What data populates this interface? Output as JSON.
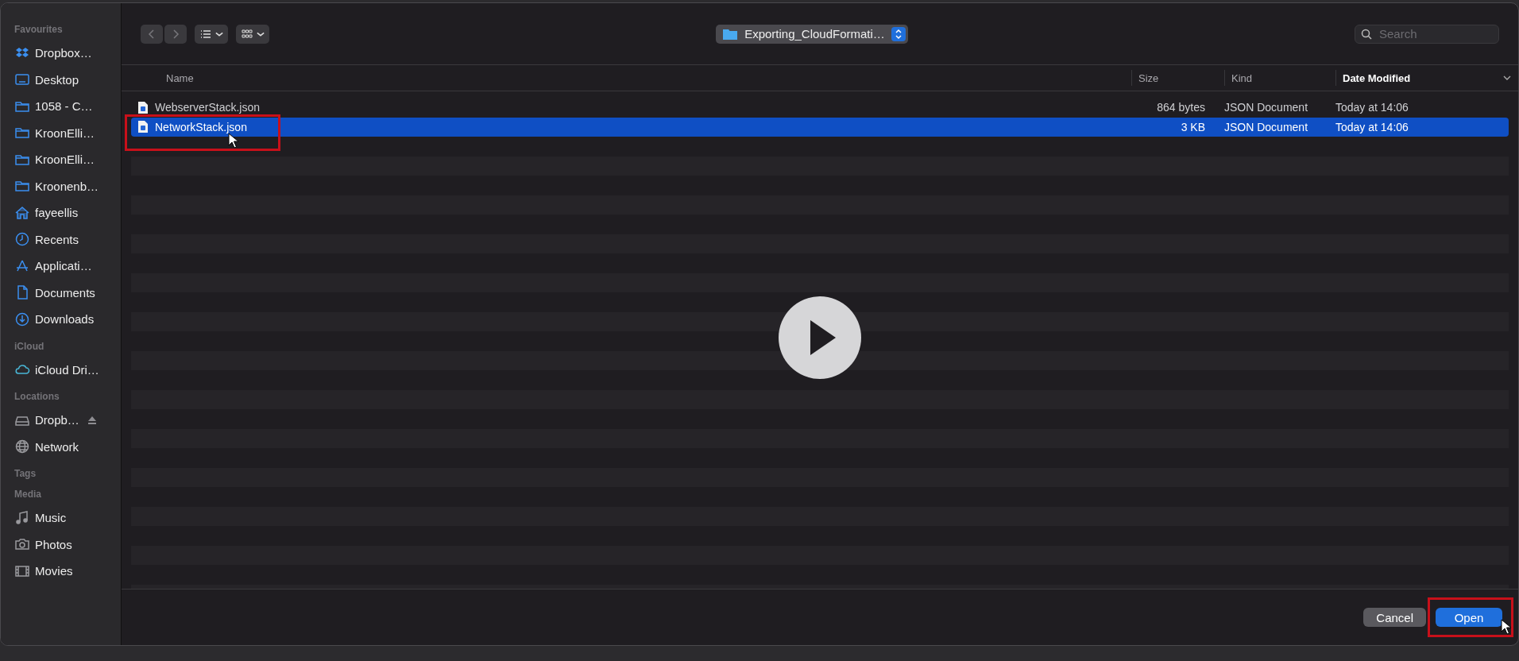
{
  "sidebar": {
    "sections": [
      {
        "heading": "Favourites",
        "items": [
          {
            "label": "Dropbox…",
            "kind": "dropbox"
          },
          {
            "label": "Desktop",
            "kind": "desktop"
          },
          {
            "label": "1058 - C…",
            "kind": "folder"
          },
          {
            "label": "KroonElli…",
            "kind": "folder"
          },
          {
            "label": "KroonElli…",
            "kind": "folder"
          },
          {
            "label": "Kroonenb…",
            "kind": "folder"
          },
          {
            "label": "fayeellis",
            "kind": "home"
          },
          {
            "label": "Recents",
            "kind": "clock"
          },
          {
            "label": "Applicati…",
            "kind": "apps"
          },
          {
            "label": "Documents",
            "kind": "document"
          },
          {
            "label": "Downloads",
            "kind": "download"
          }
        ]
      },
      {
        "heading": "iCloud",
        "items": [
          {
            "label": "iCloud Dri…",
            "kind": "cloud"
          }
        ]
      },
      {
        "heading": "Locations",
        "items": [
          {
            "label": "Dropb…",
            "kind": "drive",
            "ejectable": true
          },
          {
            "label": "Network",
            "kind": "globe",
            "ejectable": false
          }
        ]
      },
      {
        "heading": "Tags"
      },
      {
        "heading": "Media",
        "items": [
          {
            "label": "Music",
            "kind": "music"
          },
          {
            "label": "Photos",
            "kind": "camera"
          },
          {
            "label": "Movies",
            "kind": "film"
          }
        ]
      }
    ]
  },
  "toolbar": {
    "path": "Exporting_CloudFormati…",
    "search": {
      "placeholder": "Search"
    }
  },
  "columns": [
    {
      "label": "Name",
      "sorted": false
    },
    {
      "label": "Size",
      "sorted": false
    },
    {
      "label": "Kind",
      "sorted": false
    },
    {
      "label": "Date Modified",
      "sorted": true
    }
  ],
  "files": [
    {
      "name": "WebserverStack.json",
      "size": "864 bytes",
      "kind": "JSON Document",
      "date": "Today at 14:06",
      "selected": false,
      "highlighted": false
    },
    {
      "name": "NetworkStack.json",
      "size": "3 KB",
      "kind": "JSON Document",
      "date": "Today at 14:06",
      "selected": true,
      "highlighted": true
    }
  ],
  "buttons": [
    {
      "label": "Cancel",
      "kind": "secondary",
      "highlighted": false
    },
    {
      "label": "Open",
      "kind": "default",
      "highlighted": true
    }
  ]
}
